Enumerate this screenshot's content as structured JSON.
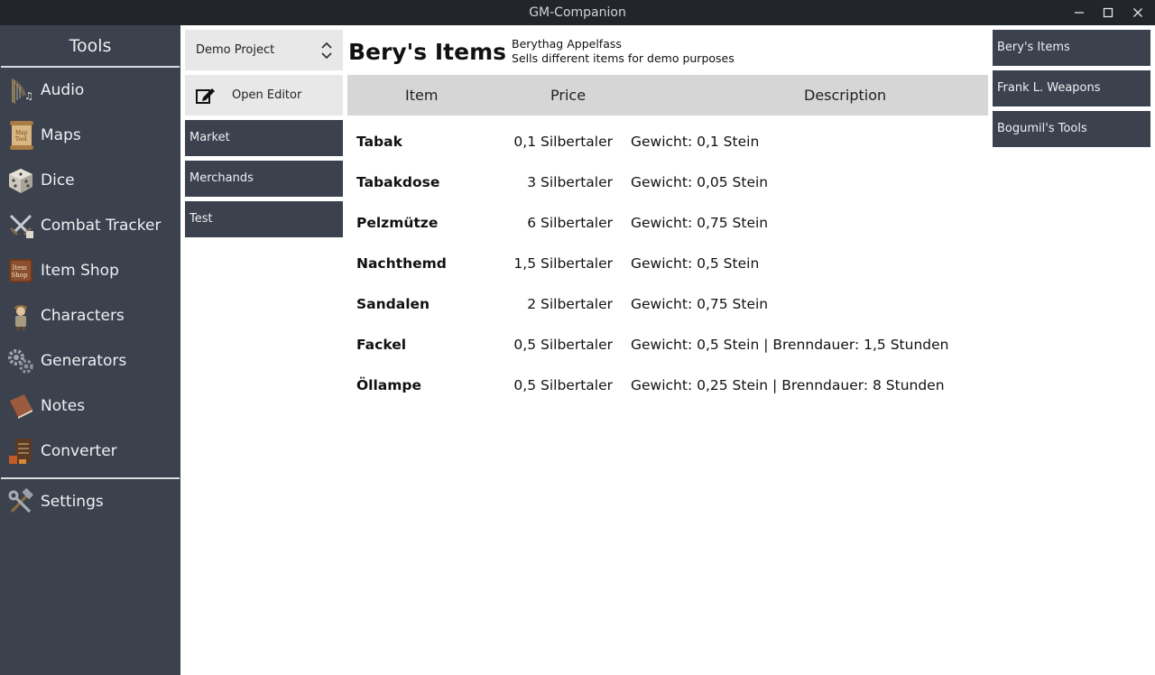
{
  "window": {
    "title": "GM-Companion",
    "controls": [
      "minimize-icon",
      "maximize-icon",
      "close-icon"
    ]
  },
  "sidebar": {
    "title": "Tools",
    "items": [
      {
        "label": "Audio",
        "icon": "lyre-icon"
      },
      {
        "label": "Maps",
        "icon": "map-scroll-icon"
      },
      {
        "label": "Dice",
        "icon": "dice-icon"
      },
      {
        "label": "Combat Tracker",
        "icon": "crossed-swords-icon"
      },
      {
        "label": "Item Shop",
        "icon": "item-shop-sign-icon"
      },
      {
        "label": "Characters",
        "icon": "character-icon"
      },
      {
        "label": "Generators",
        "icon": "gears-icon"
      },
      {
        "label": "Notes",
        "icon": "book-icon"
      },
      {
        "label": "Converter",
        "icon": "converter-icon"
      }
    ],
    "settings": {
      "label": "Settings",
      "icon": "hammer-wrench-icon"
    }
  },
  "project": {
    "selected": "Demo Project",
    "open_editor_label": "Open Editor"
  },
  "categories": [
    "Market",
    "Merchands",
    "Test"
  ],
  "shop": {
    "name": "Bery's Items",
    "owner": "Berythag Appelfass",
    "description": "Sells different items for demo purposes"
  },
  "table": {
    "headers": {
      "item": "Item",
      "price": "Price",
      "description": "Description"
    },
    "rows": [
      {
        "item": "Tabak",
        "price": "0,1 Silbertaler",
        "description": "Gewicht: 0,1 Stein"
      },
      {
        "item": "Tabakdose",
        "price": "3 Silbertaler",
        "description": "Gewicht: 0,05 Stein"
      },
      {
        "item": "Pelzmütze",
        "price": "6 Silbertaler",
        "description": "Gewicht: 0,75 Stein"
      },
      {
        "item": "Nachthemd",
        "price": "1,5 Silbertaler",
        "description": "Gewicht: 0,5 Stein"
      },
      {
        "item": "Sandalen",
        "price": "2 Silbertaler",
        "description": "Gewicht: 0,75 Stein"
      },
      {
        "item": "Fackel",
        "price": "0,5 Silbertaler",
        "description": "Gewicht: 0,5 Stein | Brenndauer: 1,5 Stunden"
      },
      {
        "item": "Öllampe",
        "price": "0,5 Silbertaler",
        "description": "Gewicht: 0,25 Stein | Brenndauer: 8 Stunden"
      }
    ]
  },
  "shops": [
    "Bery's Items",
    "Frank L. Weapons",
    "Bogumil's Tools"
  ],
  "colors": {
    "titlebar": "#22262c",
    "sidebar": "#3b414d",
    "panel_light": "#e8e8e8",
    "table_header": "#d6d6d6"
  }
}
